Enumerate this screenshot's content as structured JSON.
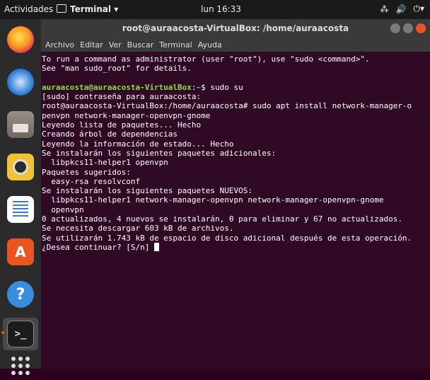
{
  "topbar": {
    "activities": "Actividades",
    "app_menu": "Terminal ▾",
    "clock": "lun 16:33",
    "tray": [
      "⁂",
      "🔊",
      "⏻▾"
    ]
  },
  "dock": {
    "software_glyph": "A",
    "help_glyph": "?",
    "terminal_glyph": ">_"
  },
  "window": {
    "title": "root@auraacosta-VirtualBox: /home/auraacosta",
    "menu": [
      "Archivo",
      "Editar",
      "Ver",
      "Buscar",
      "Terminal",
      "Ayuda"
    ]
  },
  "terminal": {
    "lines": [
      "To run a command as administrator (user \"root\"), use \"sudo <command>\".",
      "See \"man sudo_root\" for details.",
      "",
      "",
      "[sudo] contraseña para auraacosta:",
      "root@auraacosta-VirtualBox:/home/auraacosta# sudo apt install network-manager-o",
      "penvpn network-manager-openvpn-gnome",
      "Leyendo lista de paquetes... Hecho",
      "Creando árbol de dependencias",
      "Leyendo la información de estado... Hecho",
      "Se instalarán los siguientes paquetes adicionales:",
      "  libpkcs11-helper1 openvpn",
      "Paquetes sugeridos:",
      "  easy-rsa resolvconf",
      "Se instalarán los siguientes paquetes NUEVOS:",
      "  libpkcs11-helper1 network-manager-openvpn network-manager-openvpn-gnome",
      "  openvpn",
      "0 actualizados, 4 nuevos se instalarán, 0 para eliminar y 67 no actualizados.",
      "Se necesita descargar 603 kB de archivos.",
      "Se utilizarán 1.743 kB de espacio de disco adicional después de esta operación.",
      "¿Desea continuar? [S/n] "
    ],
    "prompt_user": "auraacosta@auraacosta-VirtualBox",
    "prompt_sep": ":",
    "prompt_path": "~",
    "prompt_cmd": "$ sudo su"
  },
  "colors": {
    "terminal_bg": "#300a24",
    "prompt_user": "#8ae234",
    "prompt_path": "#729fcf",
    "accent": "#e95420"
  }
}
